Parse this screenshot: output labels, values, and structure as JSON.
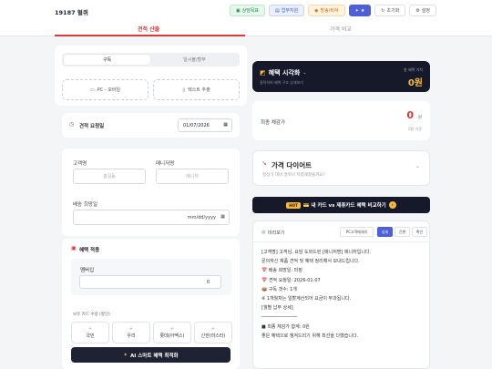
{
  "header": {
    "brand": "19187 혈퀴",
    "buttons": [
      "상담목표",
      "업무지원",
      "방송/비서",
      "★",
      "초기화",
      "설정"
    ]
  },
  "tabs": [
    "견적 산출",
    "가격 비교"
  ],
  "left": {
    "segment": [
      "구독",
      "일시불/할부"
    ],
    "modes": [
      "PC - 모바일",
      "텍스트 추출"
    ],
    "quote_date_label": "견적 요청일",
    "quote_date_value": "01/07/2026",
    "customer_label": "고객명",
    "customer_placeholder": "홍길동",
    "manager_label": "매니저명",
    "manager_placeholder": "매니저",
    "delivery_label": "배송 희망일",
    "delivery_placeholder": "mm/dd/yyyy",
    "benefit_title": "혜택 적용",
    "membership_label": "멤버십",
    "membership_value": "0",
    "cards_label": "보유 카드 수량 (할인)",
    "cards": [
      "국민",
      "우리",
      "롯데(아멕스)",
      "신한(마스터)"
    ],
    "ai_button": "AI 스마트 혜택 최적화"
  },
  "right": {
    "viz_title": "혜택 시각화",
    "viz_sub": "클릭하여 혜택 구조 상세보기",
    "viz_r1": "총 혜택 가치",
    "viz_r2": "0원",
    "final_label": "최종 체감가",
    "final_value": "0",
    "final_unit": "원",
    "final_sub": "0원 기준",
    "diet_title": "가격 다이어트",
    "diet_sub": "정상가 대비 얼마나 저렴해졌을까요?",
    "banner": "💳 내 카드 vs 제휴카드 혜택 비교하기",
    "banner_tag": "HOT",
    "preview_label": "미리보기",
    "preview_tabs": [
      "PC고객메세지",
      "상세",
      "간편",
      "확인"
    ],
    "preview_lines": [
      "[고객명] 고객님, 요담 도와드린 [매니저명] 매니저입니다.",
      "문의하신 제품 견적 및 혜택 정리해서 보내드립니다.",
      "",
      "📅 배송 희망일: 미정",
      "📅 견적 요청일: 2026-01-07",
      "📦 구독 갯수: 1개",
      "※ 1개월차는 일할계산되어 요금이 부과됩니다.",
      "",
      "[월별 납부 상세]",
      "─────────────",
      "■ 최종 체감가 합계: 0원",
      "",
      "좋은 혜택으로 챙겨드리기 위해 최선을 다했습니다."
    ]
  },
  "colors": {
    "accent": "#d93a3a",
    "dark": "#15192a",
    "gold": "#f6b93b"
  }
}
